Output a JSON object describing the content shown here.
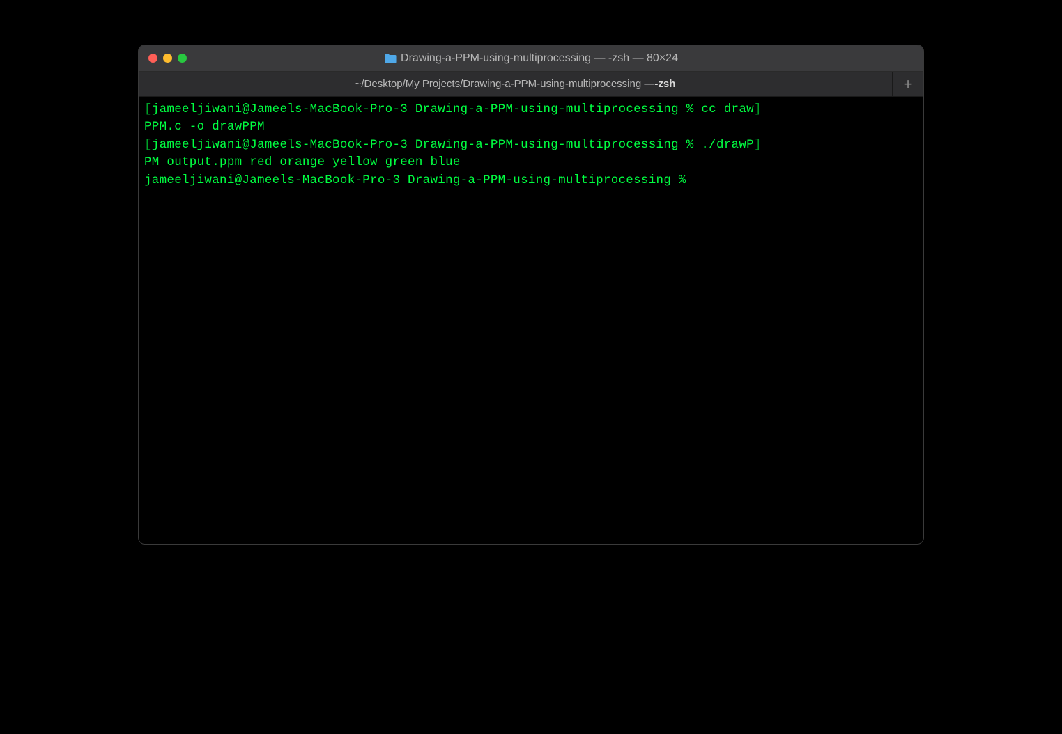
{
  "window": {
    "title": "Drawing-a-PPM-using-multiprocessing — -zsh — 80×24",
    "icon": "folder-icon"
  },
  "tab": {
    "path_prefix": "~/Desktop/My Projects/Drawing-a-PPM-using-multiprocessing — ",
    "shell": "-zsh"
  },
  "traffic_lights": {
    "close": "close",
    "minimize": "minimize",
    "zoom": "zoom"
  },
  "new_tab_label": "+",
  "terminal": {
    "lines": [
      {
        "lb": "[",
        "prompt": "jameeljiwani@Jameels-MacBook-Pro-3 Drawing-a-PPM-using-multiprocessing % ",
        "cmd": "cc draw",
        "rb": "]"
      },
      {
        "cont": "PPM.c -o drawPPM"
      },
      {
        "lb": "[",
        "prompt": "jameeljiwani@Jameels-MacBook-Pro-3 Drawing-a-PPM-using-multiprocessing % ",
        "cmd": "./drawP",
        "rb": "]"
      },
      {
        "cont": "PM output.ppm red orange yellow green blue"
      },
      {
        "lb": "",
        "prompt": "jameeljiwani@Jameels-MacBook-Pro-3 Drawing-a-PPM-using-multiprocessing % ",
        "cmd": ""
      }
    ]
  }
}
